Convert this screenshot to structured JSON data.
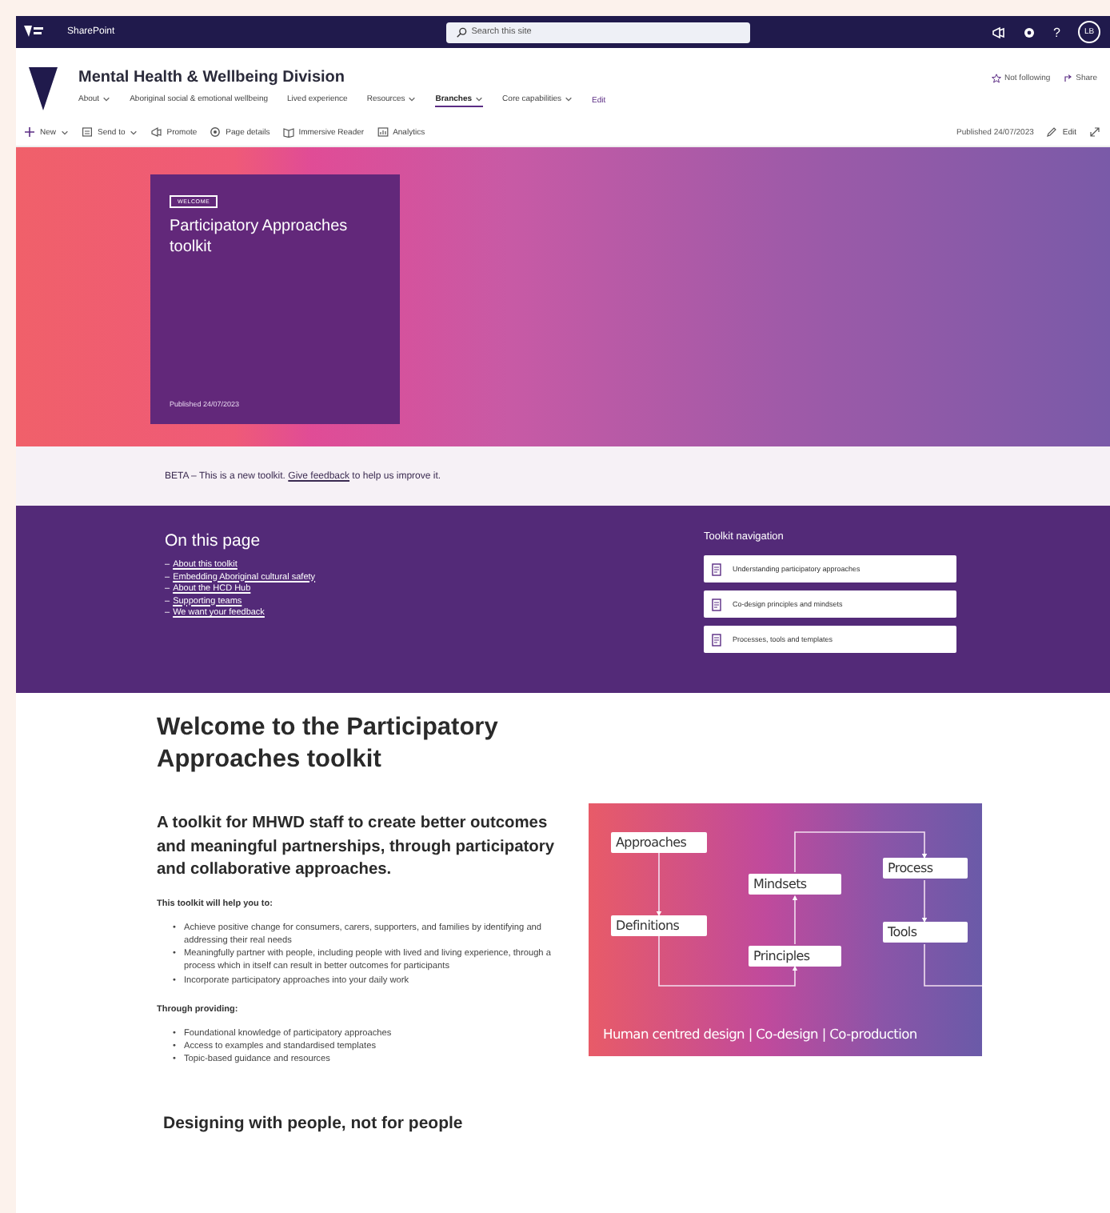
{
  "top_bar": {
    "app_name": "SharePoint",
    "search": {
      "placeholder": "Search this site"
    },
    "help": "?",
    "avatar": "LB"
  },
  "site_header": {
    "title": "Mental Health & Wellbeing Division",
    "nav": [
      {
        "label": "About",
        "dropdown": true,
        "selected": false
      },
      {
        "label": "Aboriginal social & emotional wellbeing",
        "dropdown": false,
        "selected": false
      },
      {
        "label": "Lived experience",
        "dropdown": false,
        "selected": false
      },
      {
        "label": "Resources",
        "dropdown": true,
        "selected": false
      },
      {
        "label": "Branches",
        "dropdown": true,
        "selected": true
      },
      {
        "label": "Core capabilities",
        "dropdown": true,
        "selected": false
      }
    ],
    "edit_link": "Edit",
    "follow": "Not following",
    "share": "Share"
  },
  "command_bar": {
    "items": [
      {
        "kind": "new",
        "label": "New",
        "dropdown": true
      },
      {
        "kind": "send",
        "label": "Send to",
        "dropdown": true
      },
      {
        "kind": "promote",
        "label": "Promote",
        "dropdown": false
      },
      {
        "kind": "details",
        "label": "Page details",
        "dropdown": false
      },
      {
        "kind": "reader",
        "label": "Immersive Reader",
        "dropdown": false
      },
      {
        "kind": "analytics",
        "label": "Analytics",
        "dropdown": false
      }
    ],
    "published": "Published 24/07/2023",
    "edit": "Edit"
  },
  "hero": {
    "tag": "WELCOME",
    "title": "Participatory Approaches toolkit",
    "published": "Published 24/07/2023"
  },
  "banner": {
    "before": "BETA – This is a new toolkit. ",
    "link": "Give feedback",
    "after": " to help us improve it."
  },
  "on_this_page": {
    "heading": "On this page",
    "links": [
      {
        "mark": "–",
        "label": "About this toolkit"
      },
      {
        "mark": "–",
        "label": "Embedding Aboriginal cultural safety"
      },
      {
        "mark": "–",
        "label": "About the HCD Hub"
      },
      {
        "mark": "–",
        "label": "Supporting teams"
      },
      {
        "mark": "–",
        "label": "We want your feedback"
      }
    ]
  },
  "toolkit_navigation": {
    "heading": "Toolkit navigation",
    "items": [
      "Understanding participatory approaches",
      "Co-design principles and mindsets",
      "Processes, tools and templates"
    ]
  },
  "content": {
    "heading": "Welcome to the Participatory Approaches toolkit",
    "subheading": "A toolkit for MHWD staff to create better outcomes and meaningful partnerships, through participatory and collaborative approaches.",
    "intro_1": "This toolkit will help you to:",
    "list_1": [
      {
        "bullet": "•",
        "text": "Achieve positive change for consumers, carers, supporters, and families by identifying and addressing their real needs"
      },
      {
        "bullet": "•",
        "text": "Meaningfully partner with people, including people with lived and living experience, through a process which in itself can result in better outcomes for participants"
      },
      {
        "bullet": "•",
        "text": "Incorporate participatory approaches into your daily work"
      }
    ],
    "intro_2": "Through providing:",
    "list_2": [
      {
        "bullet": "•",
        "text": "Foundational knowledge of participatory approaches"
      },
      {
        "bullet": "•",
        "text": "Access to examples and standardised templates"
      },
      {
        "bullet": "•",
        "text": "Topic-based guidance and resources"
      }
    ],
    "heading_2": "Designing with people, not for people"
  },
  "diagram": {
    "nodes": [
      "Approaches",
      "Definitions",
      "Mindsets",
      "Principles",
      "Process",
      "Tools"
    ],
    "caption": "Human centred design | Co-design | Co-production"
  }
}
